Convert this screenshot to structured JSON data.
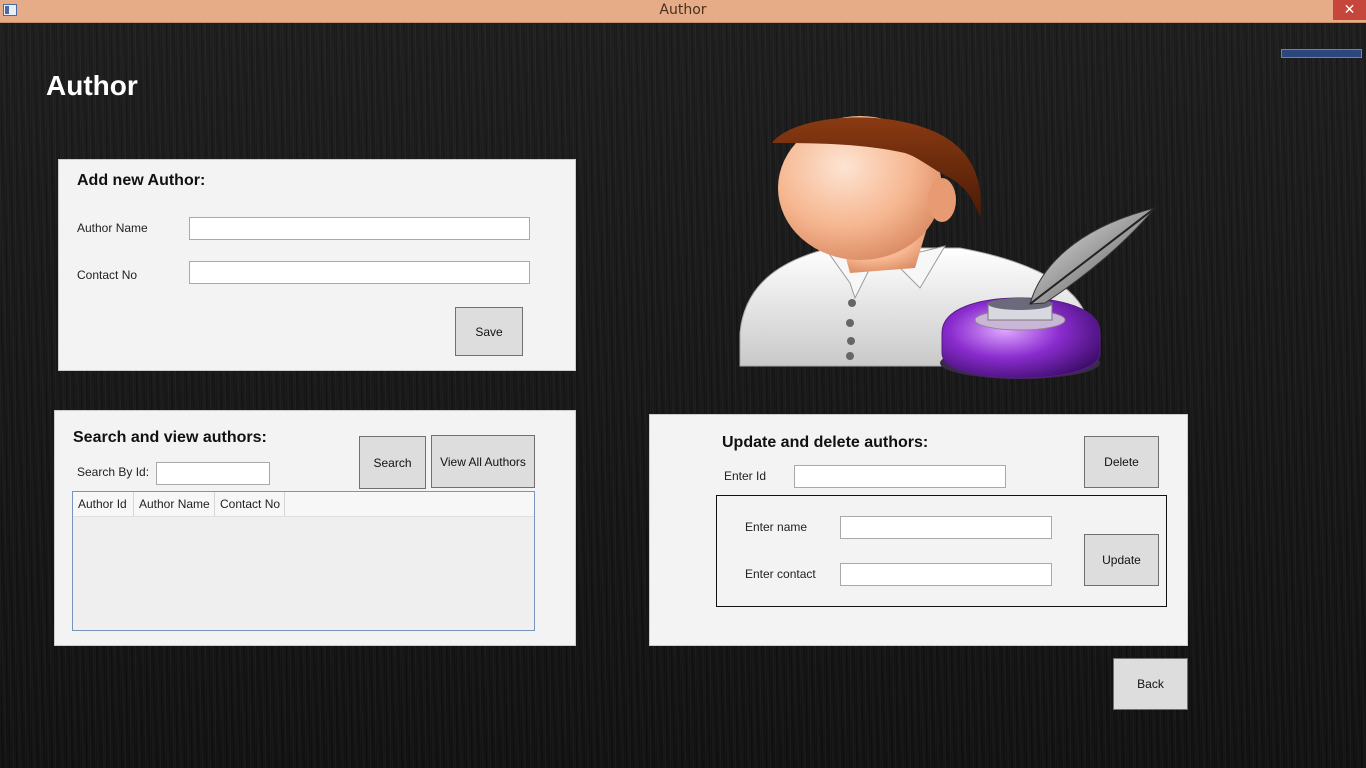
{
  "window": {
    "title": "Author"
  },
  "page": {
    "title": "Author"
  },
  "add_panel": {
    "heading": "Add new Author:",
    "author_name_label": "Author Name",
    "contact_label": "Contact No",
    "author_name_value": "",
    "contact_value": "",
    "save_label": "Save"
  },
  "search_panel": {
    "heading": "Search and view authors:",
    "search_by_id_label": "Search By Id:",
    "search_by_id_value": "",
    "search_label": "Search",
    "view_all_label": "View All Authors",
    "columns": [
      "Author Id",
      "Author Name",
      "Contact No"
    ],
    "rows": []
  },
  "update_panel": {
    "heading": "Update and delete authors:",
    "enter_id_label": "Enter Id",
    "enter_id_value": "",
    "delete_label": "Delete",
    "enter_name_label": "Enter name",
    "enter_name_value": "",
    "enter_contact_label": "Enter contact",
    "enter_contact_value": "",
    "update_label": "Update"
  },
  "back_label": "Back",
  "icons": {
    "app": "window-icon",
    "close": "close-icon",
    "hero": "author-with-quill-illustration"
  },
  "colors": {
    "titlebar": "#e5ac87",
    "close_button": "#c7463b",
    "panel": "#f3f3f3",
    "button": "#dddddd"
  }
}
